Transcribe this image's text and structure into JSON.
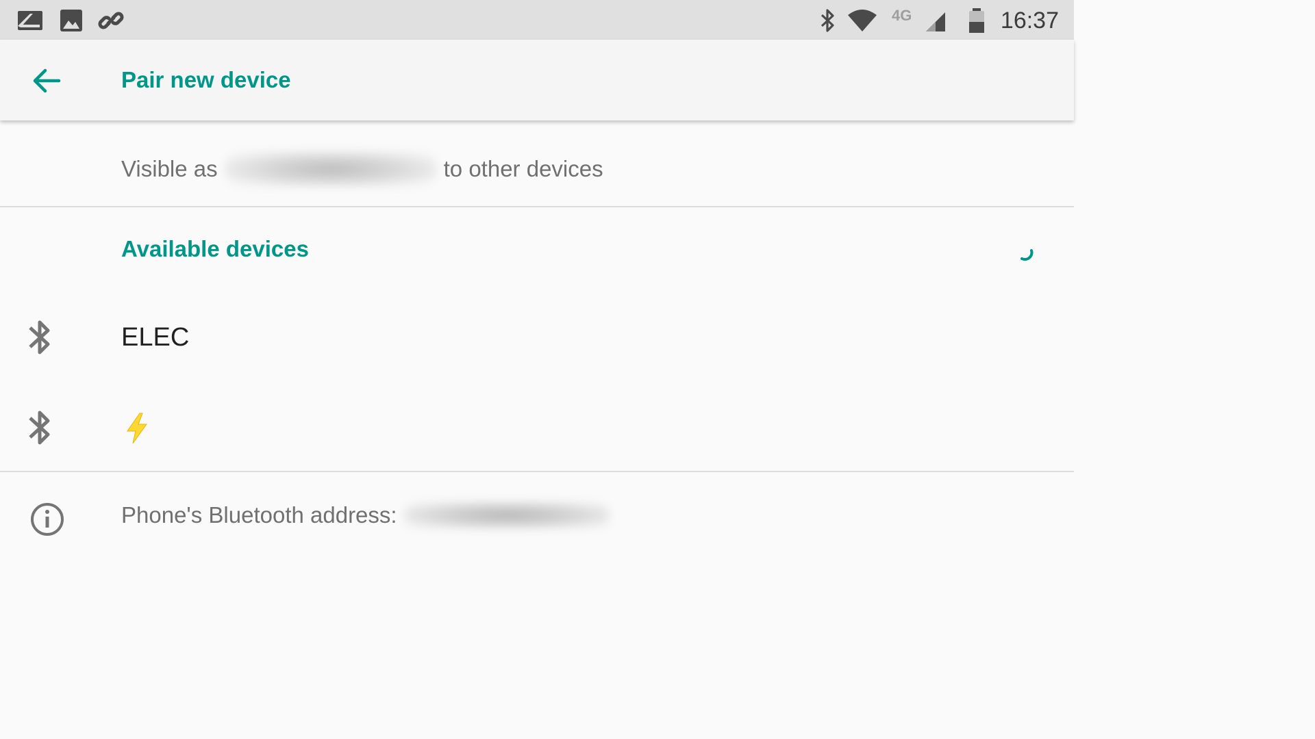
{
  "status_bar": {
    "time": "16:37",
    "network_type": "4G",
    "left_icons": [
      "notification-icon",
      "image-icon",
      "link-icon"
    ],
    "right_icons": [
      "bluetooth-icon",
      "wifi-icon",
      "signal-icon",
      "battery-icon"
    ]
  },
  "app_bar": {
    "title": "Pair new device",
    "back_icon": "arrow-back-icon"
  },
  "visibility": {
    "prefix": "Visible as",
    "suffix": "to other devices"
  },
  "available": {
    "header": "Available devices",
    "spinner_icon": "progress-spinner"
  },
  "devices": [
    {
      "name": "ELEC",
      "icon": "bluetooth-icon"
    },
    {
      "name": "",
      "icon": "bluetooth-icon",
      "name_icon": "lightning-bolt-icon"
    }
  ],
  "footer": {
    "address_label": "Phone's Bluetooth address:",
    "info_icon": "info-icon"
  },
  "colors": {
    "accent": "#009688",
    "secondary_text": "#707070",
    "primary_text": "#212121",
    "status_bar_bg": "#e0e0e0",
    "bolt": "#fdd835"
  }
}
